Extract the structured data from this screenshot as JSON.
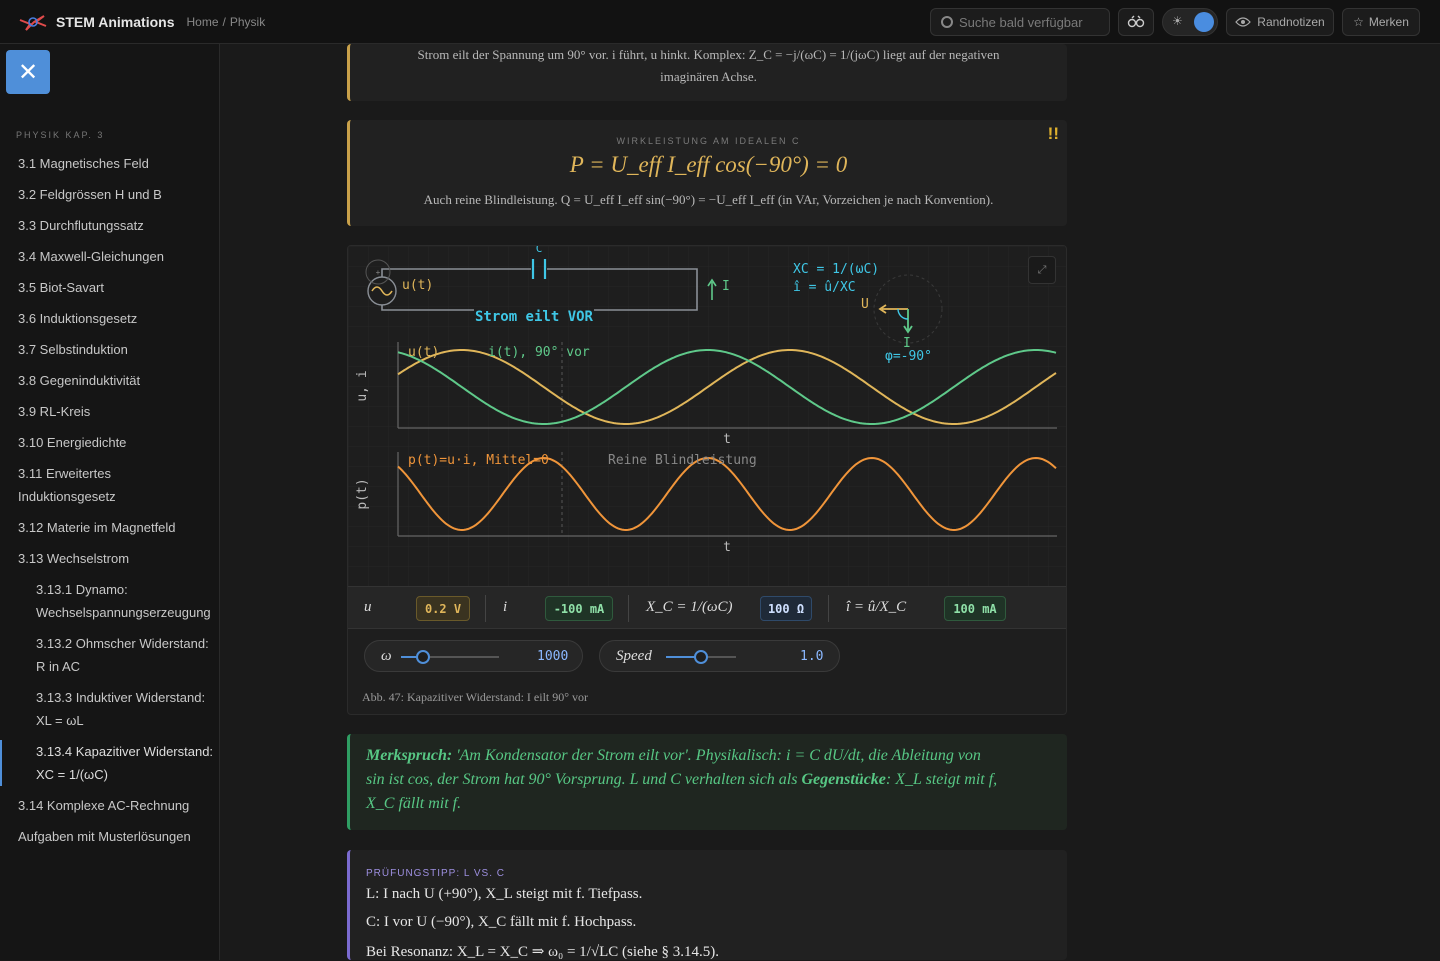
{
  "topbar": {
    "brand": "STEM Animations",
    "crumbs": [
      "Home",
      "/",
      "Physik"
    ],
    "search_placeholder": "Suche bald verfügbar",
    "notes_label": "Randnotizen",
    "bookmark_label": "Merken",
    "theme_icon": "☀"
  },
  "sidebar": {
    "close_label": "✕",
    "section_title": "PHYSIK KAP. 3",
    "items": [
      {
        "label": "3.1 Magnetisches Feld",
        "sub": false
      },
      {
        "label": "3.2 Feldgrössen H und B",
        "sub": false
      },
      {
        "label": "3.3 Durchflutungssatz",
        "sub": false
      },
      {
        "label": "3.4 Maxwell-Gleichungen",
        "sub": false
      },
      {
        "label": "3.5 Biot-Savart",
        "sub": false
      },
      {
        "label": "3.6 Induktionsgesetz",
        "sub": false
      },
      {
        "label": "3.7 Selbstinduktion",
        "sub": false
      },
      {
        "label": "3.8 Gegeninduktivität",
        "sub": false
      },
      {
        "label": "3.9 RL-Kreis",
        "sub": false
      },
      {
        "label": "3.10 Energiedichte",
        "sub": false
      },
      {
        "label": "3.11 Erweitertes Induktionsgesetz",
        "sub": false
      },
      {
        "label": "3.12 Materie im Magnetfeld",
        "sub": false
      },
      {
        "label": "3.13 Wechselstrom",
        "sub": false
      },
      {
        "label": "3.13.1 Dynamo: Wechselspannungserzeugung",
        "sub": true
      },
      {
        "label": "3.13.2 Ohmscher Widerstand: R in AC",
        "sub": true
      },
      {
        "label": "3.13.3 Induktiver Widerstand: XL = ωL",
        "sub": true
      },
      {
        "label": "3.13.4 Kapazitiver Widerstand: XC = 1/(ωC)",
        "sub": true,
        "active": true
      },
      {
        "label": "3.14 Komplexe AC-Rechnung",
        "sub": false
      },
      {
        "label": "Aufgaben mit Musterlösungen",
        "sub": false
      }
    ]
  },
  "note1": {
    "line1": "Strom eilt der Spannung um 90° vor. i führt, u hinkt. Komplex: Z_C = −j/(ωC) = 1/(jωC) liegt auf der negativen",
    "line2": "imaginären Achse."
  },
  "note2": {
    "label": "WIRKLEISTUNG AM IDEALEN C",
    "equation": "P = U_eff I_eff cos(−90°) = 0",
    "subtext": "Auch reine Blindleistung. Q = U_eff I_eff sin(−90°) = −U_eff I_eff (in VAr, Vorzeichen je nach Konvention).",
    "badge": "!!"
  },
  "figure": {
    "circuit": {
      "cap_label": "C",
      "source_label": "u(t)",
      "current_label": "I",
      "caption": "Strom eilt VOR"
    },
    "phasor": {
      "line1": "XC = 1/(ωC)",
      "line2": "î = û/XC",
      "u_label": "U",
      "i_label": "I",
      "phi_label": "φ=-90°"
    },
    "plot1": {
      "ylabel": "u, i",
      "xlabel": "t",
      "u_legend": "u(t)",
      "i_legend": "i(t), 90° vor"
    },
    "plot2": {
      "ylabel": "p(t)",
      "xlabel": "t",
      "legend": "p(t)=u·i, Mittel=0",
      "annotation": "Reine Blindleistung"
    },
    "readouts": [
      {
        "label": "u",
        "value": "0.2 V"
      },
      {
        "label": "i",
        "value": "-100 mA"
      },
      {
        "label": "X_C = 1/(ωC)",
        "value": "100 Ω"
      },
      {
        "label": "î = û/X_C",
        "value": "100 mA"
      }
    ],
    "omega": {
      "label": "ω",
      "value": "1000",
      "fraction": 0.22
    },
    "speed": {
      "label": "Speed",
      "value": "1.0",
      "fraction": 0.5
    },
    "caption": "Abb. 47: Kapazitiver Widerstand: I eilt 90° vor"
  },
  "merk": {
    "lead": "Merkspruch:",
    "text1": " 'Am Kondensator der Strom eilt vor'. Physikalisch: i = C dU/dt, die Ableitung von",
    "text2": "sin ist cos, der Strom hat 90° Vorsprung. L und C verhalten sich als ",
    "strong": "Gegenstücke",
    "text3": ": X_L steigt mit f,",
    "text4": "X_C fällt mit f."
  },
  "tipp": {
    "label": "PRÜFUNGSTIPP: L VS. C",
    "line1": "L: I nach U (+90°), X_L steigt mit f. Tiefpass.",
    "line2": "C: I vor U (−90°), X_C fällt mit f. Hochpass.",
    "line3": "Bei Resonanz: X_L = X_C ⇒ ω₀ = 1/√LC (siehe § 3.14.5)."
  },
  "colors": {
    "accent_blue": "#4f8fd9",
    "voltage": "#e0b65a",
    "current": "#5fc98a",
    "power": "#f0953a",
    "cyan": "#3fc7e6"
  }
}
